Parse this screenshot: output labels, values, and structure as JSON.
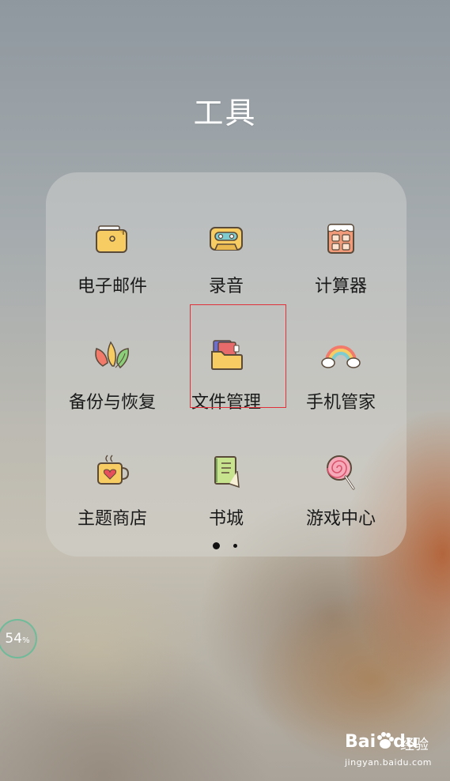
{
  "folder": {
    "title": "工具",
    "apps": [
      {
        "label": "电子邮件",
        "icon": "email-folder-icon"
      },
      {
        "label": "录音",
        "icon": "cassette-recorder-icon"
      },
      {
        "label": "计算器",
        "icon": "calculator-icon"
      },
      {
        "label": "备份与恢复",
        "icon": "leaves-backup-icon"
      },
      {
        "label": "文件管理",
        "icon": "file-manager-icon"
      },
      {
        "label": "手机管家",
        "icon": "rainbow-cloud-icon"
      },
      {
        "label": "主题商店",
        "icon": "coffee-cup-heart-icon"
      },
      {
        "label": "书城",
        "icon": "book-icon"
      },
      {
        "label": "游戏中心",
        "icon": "lollipop-icon"
      }
    ],
    "page_indicator": {
      "pages": 2,
      "current": 1
    }
  },
  "highlighted_app": "文件管理",
  "highlight_color": "#e0303a",
  "battery": {
    "value": "54",
    "unit": "%"
  },
  "watermark": {
    "logo": "Bai",
    "logo_suffix": "du",
    "product": "经验",
    "url": "jingyan.baidu.com"
  }
}
